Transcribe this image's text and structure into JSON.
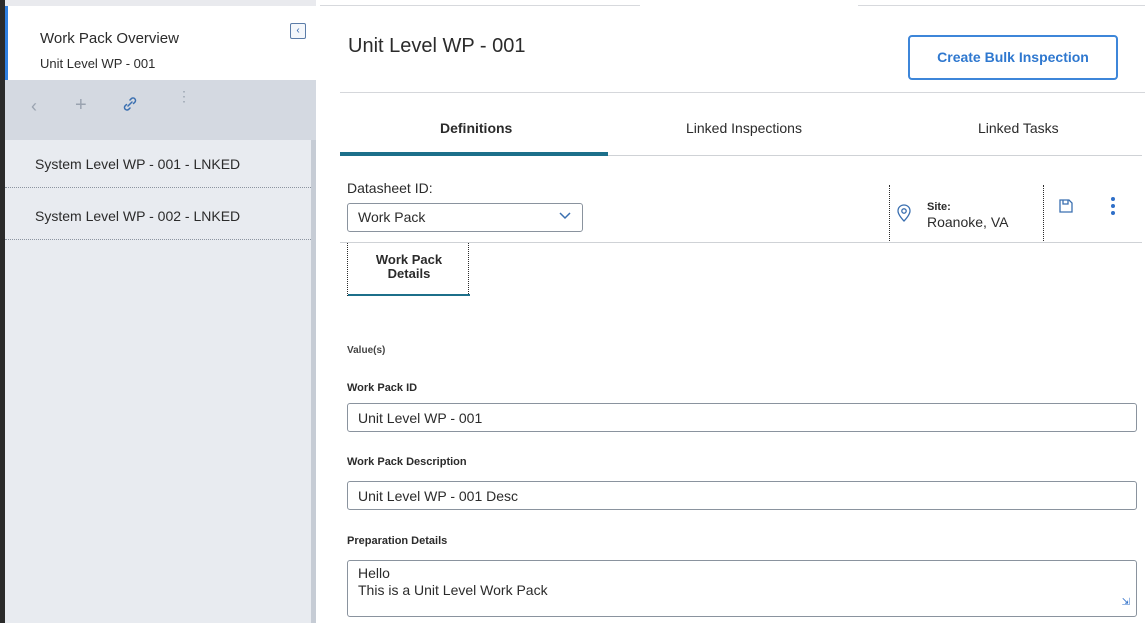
{
  "sidebar": {
    "overview_title": "Work Pack Overview",
    "overview_subtitle": "Unit Level WP - 001",
    "collapse_icon": "chevron-left-icon",
    "toolbar_icons": [
      "back-icon",
      "add-icon",
      "link-icon",
      "more-vertical-icon"
    ],
    "items": [
      {
        "label": "System Level WP - 001 - LNKED"
      },
      {
        "label": "System Level WP - 002 - LNKED"
      }
    ]
  },
  "header": {
    "title": "Unit Level WP - 001",
    "bulk_button_label": "Create Bulk Inspection",
    "accent_color": "#2f78cf"
  },
  "tabs": [
    {
      "label": "Definitions",
      "active": true
    },
    {
      "label": "Linked Inspections",
      "active": false
    },
    {
      "label": "Linked Tasks",
      "active": false
    }
  ],
  "datasheet": {
    "label": "Datasheet ID:",
    "selected": "Work Pack"
  },
  "site": {
    "label": "Site:",
    "value": "Roanoke, VA"
  },
  "section_tab": {
    "line1": "Work Pack",
    "line2": "Details"
  },
  "form": {
    "values_label": "Value(s)",
    "work_pack_id_label": "Work Pack ID",
    "work_pack_id_value": "Unit Level WP - 001",
    "description_label": "Work Pack Description",
    "description_value": "Unit Level WP - 001 Desc",
    "prep_label": "Preparation Details",
    "prep_line1": "Hello",
    "prep_line2": "This is a Unit Level Work Pack"
  }
}
